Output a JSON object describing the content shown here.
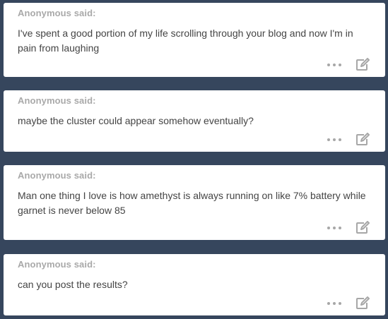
{
  "posts": [
    {
      "asker": "Anonymous said:",
      "question": "I've spent a good portion of my life scrolling through your blog and now I'm in pain from laughing",
      "more_icon": "ellipsis-icon",
      "edit_icon": "edit-icon"
    },
    {
      "asker": "Anonymous said:",
      "question": "maybe the cluster could appear somehow eventually?",
      "more_icon": "ellipsis-icon",
      "edit_icon": "edit-icon"
    },
    {
      "asker": "Anonymous said:",
      "question": "Man one thing I love is how amethyst is always running on like 7% battery while garnet is never below 85",
      "more_icon": "ellipsis-icon",
      "edit_icon": "edit-icon"
    },
    {
      "asker": "Anonymous said:",
      "question": "can you post the results?",
      "more_icon": "ellipsis-icon",
      "edit_icon": "edit-icon"
    }
  ],
  "colors": {
    "background": "#36465d",
    "card": "#ffffff",
    "asker_text": "#a9a9a9",
    "question_text": "#444444",
    "icon": "#a7a7a7"
  }
}
